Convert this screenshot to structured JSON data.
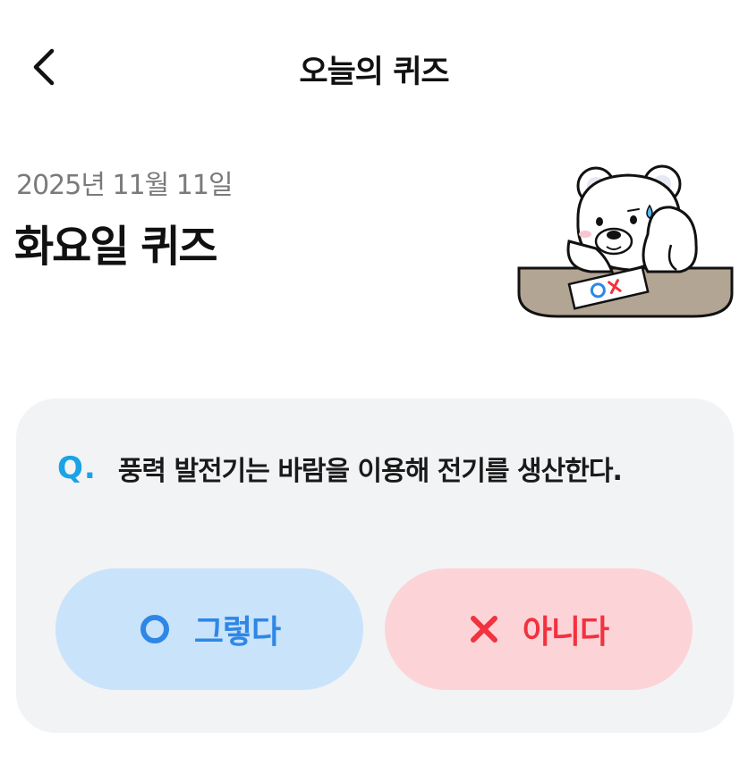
{
  "header": {
    "title": "오늘의 퀴즈",
    "back_icon": "chevron-left-icon"
  },
  "quiz": {
    "date": "2025년 11월 11일",
    "title": "화요일 퀴즈"
  },
  "question": {
    "prefix": "Q.",
    "text": "풍력 발전기는 바람을 이용해 전기를 생산한다."
  },
  "answers": {
    "yes": {
      "label": "그렇다",
      "icon": "circle-o-icon"
    },
    "no": {
      "label": "아니다",
      "icon": "x-icon"
    }
  },
  "colors": {
    "accent_q": "#1aa3e6",
    "yes_bg": "#c9e3fb",
    "yes_fg": "#2e87e6",
    "no_bg": "#fcd4d8",
    "no_fg": "#f2323f",
    "card_bg": "#f2f3f5"
  }
}
